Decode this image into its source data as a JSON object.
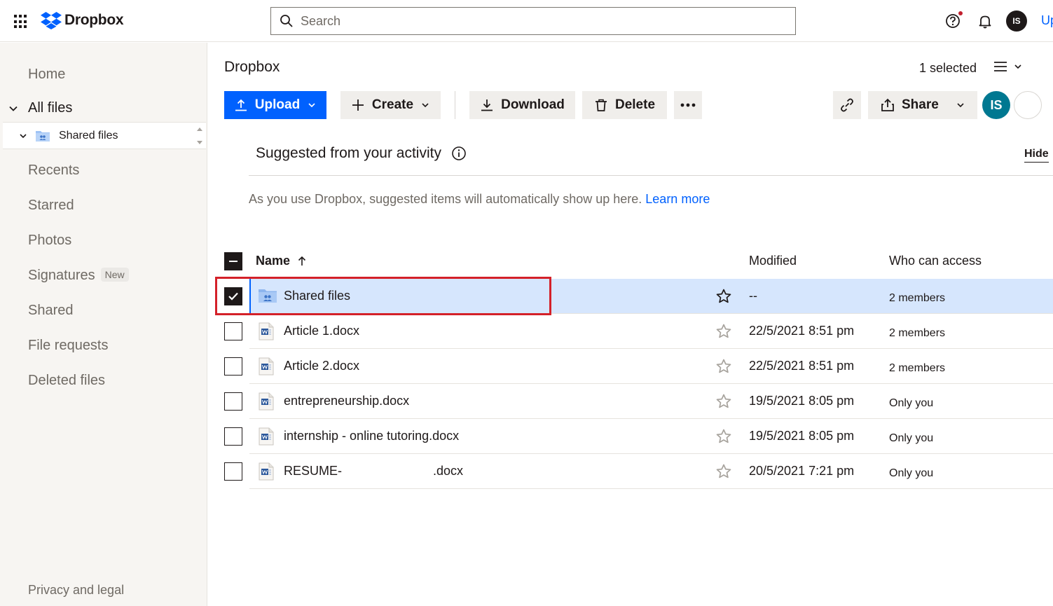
{
  "topbar": {
    "logo_text": "Dropbox",
    "search_placeholder": "Search",
    "avatar_initials": "IS",
    "upgrade_label": "Upgrade"
  },
  "sidebar": {
    "home": "Home",
    "all_files": "All files",
    "tree_item": "Shared files",
    "recents": "Recents",
    "starred": "Starred",
    "photos": "Photos",
    "signatures": "Signatures",
    "signatures_badge": "New",
    "shared": "Shared",
    "file_requests": "File requests",
    "deleted_files": "Deleted files",
    "privacy": "Privacy and legal"
  },
  "main": {
    "breadcrumb": "Dropbox",
    "selected_count": "1 selected",
    "toolbar": {
      "upload": "Upload",
      "create": "Create",
      "download": "Download",
      "delete": "Delete",
      "share": "Share",
      "avatar_initials": "IS"
    },
    "suggested": {
      "title": "Suggested from your activity",
      "hide": "Hide",
      "description": "As you use Dropbox, suggested items will automatically show up here. ",
      "learn_more": "Learn more"
    },
    "table": {
      "headers": {
        "name": "Name",
        "modified": "Modified",
        "access": "Who can access"
      },
      "rows": [
        {
          "name": "Shared files",
          "modified": "--",
          "access": "2 members",
          "type": "shared-folder"
        },
        {
          "name": "Article 1.docx",
          "modified": "22/5/2021 8:51 pm",
          "access": "2 members",
          "type": "word-doc"
        },
        {
          "name": "Article 2.docx",
          "modified": "22/5/2021 8:51 pm",
          "access": "2 members",
          "type": "word-doc"
        },
        {
          "name": "entrepreneurship.docx",
          "modified": "19/5/2021 8:05 pm",
          "access": "Only you",
          "type": "word-doc"
        },
        {
          "name": "internship - online tutoring.docx",
          "modified": "19/5/2021 8:05 pm",
          "access": "Only you",
          "type": "word-doc"
        },
        {
          "name": "RESUME-                          .docx",
          "modified": "20/5/2021 7:21 pm",
          "access": "Only you",
          "type": "word-doc"
        }
      ]
    }
  }
}
